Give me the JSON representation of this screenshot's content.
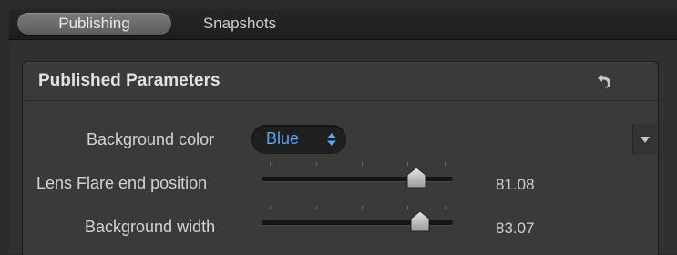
{
  "tabs": [
    {
      "label": "Publishing",
      "active": true
    },
    {
      "label": "Snapshots",
      "active": false
    }
  ],
  "panel": {
    "title": "Published Parameters",
    "reset_icon": "undo-arrow-icon"
  },
  "params": {
    "background_color": {
      "label": "Background color",
      "value": "Blue",
      "value_color": "#5aa7f2"
    },
    "lens_flare_end": {
      "label": "Lens Flare end position",
      "value": "81.08",
      "slider_level": 0.81
    },
    "background_width": {
      "label": "Background width",
      "value": "83.07",
      "slider_level": 0.83
    }
  },
  "side_arrow_icon": "triangle-down-icon"
}
